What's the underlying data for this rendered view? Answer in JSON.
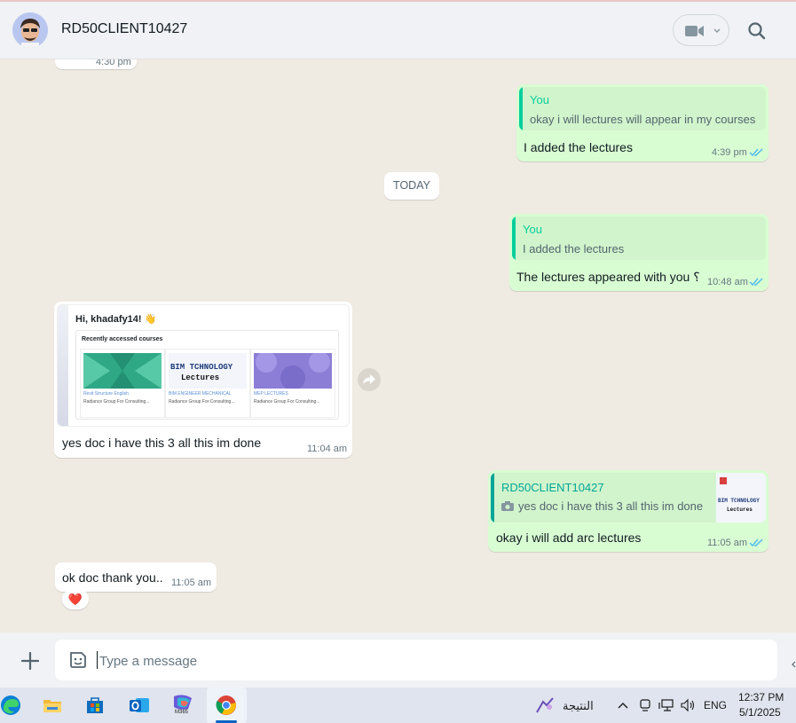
{
  "header": {
    "contact_name": "RD50CLIENT10427",
    "video_icon": "video-camera-icon",
    "search_icon": "search-icon"
  },
  "messages": {
    "partial_time": "4:30 pm",
    "m1": {
      "quote_author": "You",
      "quote_text": "okay i will lectures will appear in my courses",
      "text": "I added the lectures",
      "time": "4:39 pm"
    },
    "date_divider": "TODAY",
    "m2": {
      "quote_author": "You",
      "quote_text": "I added the lectures",
      "text": "The lectures appeared with you ؟",
      "time": "10:48 am"
    },
    "m3": {
      "text": "yes doc i have this 3 all this im done",
      "time": "11:04 am",
      "screenshot": {
        "greeting": "Hi, khadafy14! 👋",
        "section": "Recently accessed courses",
        "courses": [
          {
            "title": "Revit Structure English",
            "org": "Radiance Group For Consulting..."
          },
          {
            "title": "BIM ENGINEER MECHANICAL",
            "org": "Radiance Group For Consulting..."
          },
          {
            "title": "MEP LECTURES",
            "org": "Radiance Group For Consulting..."
          }
        ],
        "thumb_text_1": "BIM TCHNOLOGY",
        "thumb_text_2": "Lectures"
      }
    },
    "m4": {
      "quote_author": "RD50CLIENT10427",
      "quote_text": "yes doc i have this 3 all this im done",
      "text": "okay i will add arc lectures",
      "time": "11:05 am"
    },
    "m5": {
      "text": "ok doc thank you..",
      "time": "11:05 am",
      "reaction": "❤️"
    }
  },
  "composer": {
    "placeholder": "Type a message"
  },
  "taskbar": {
    "arabic_label": "النتيجة",
    "language": "ENG",
    "time": "12:37 PM",
    "date": "5/1/2025",
    "m365_label": "M365"
  },
  "colors": {
    "you_accent": "#06cf9c",
    "contact_accent": "#02a698",
    "read_ticks": "#53bdeb",
    "chat_bg": "#efeae2",
    "outgoing_bg": "#d9fdd3"
  }
}
